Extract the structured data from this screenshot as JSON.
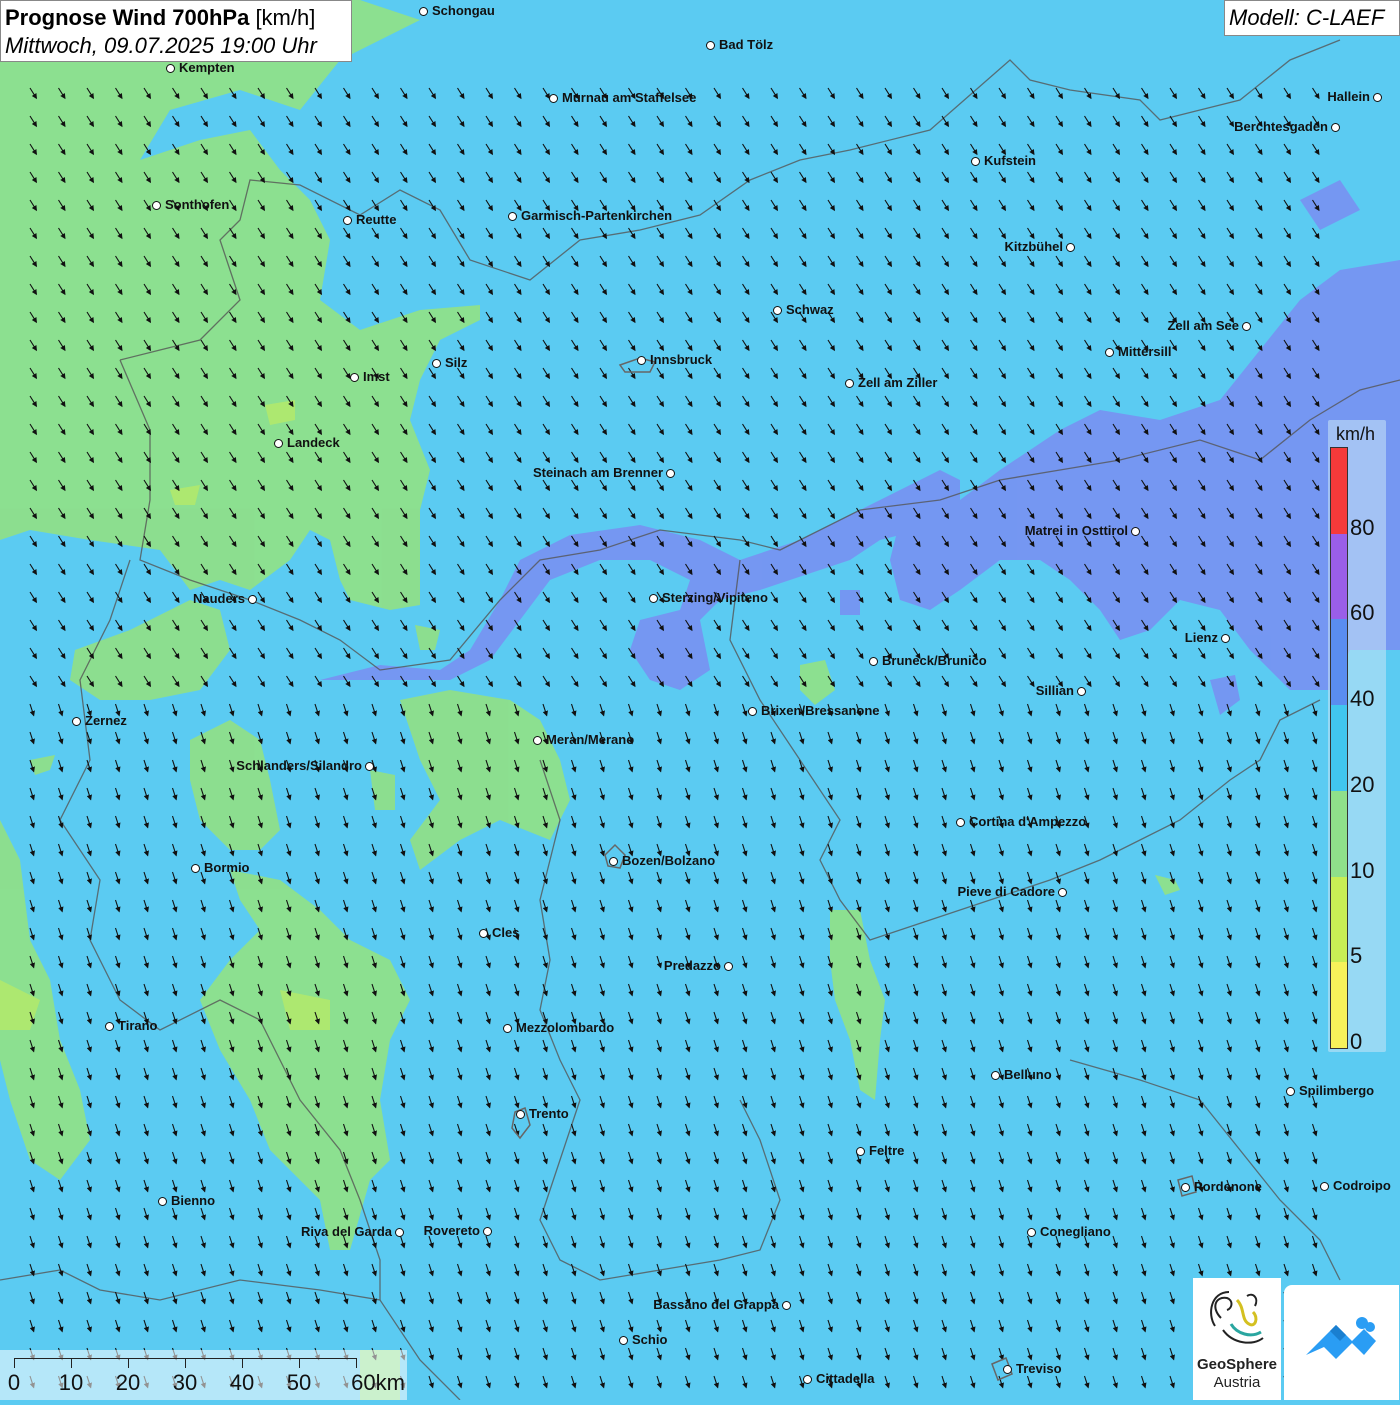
{
  "title": {
    "main": "Prognose Wind 700hPa",
    "unit": "[km/h]",
    "date": "Mittwoch, 09.07.2025 19:00 Uhr"
  },
  "model_label": "Modell: C-LAEF",
  "legend": {
    "unit": "km/h",
    "ticks": [
      "0",
      "5",
      "10",
      "20",
      "40",
      "60",
      "80"
    ],
    "colors": [
      "#f7f25a",
      "#c8ee55",
      "#8fe08a",
      "#41c6ee",
      "#5a8df0",
      "#9a5ee8",
      "#f53a3a"
    ]
  },
  "wind": {
    "arrow_direction": "from north-west, pointing south-south-east"
  },
  "scale_bar": {
    "labels": [
      "0",
      "10",
      "20",
      "30",
      "40",
      "50",
      "60km"
    ]
  },
  "cities": [
    {
      "name": "Schongau"
    },
    {
      "name": "Bad Tölz"
    },
    {
      "name": "Kempten"
    },
    {
      "name": "Murnau am Staffelsee"
    },
    {
      "name": "Hallein"
    },
    {
      "name": "Berchtesgaden"
    },
    {
      "name": "Kufstein"
    },
    {
      "name": "Sonthofen"
    },
    {
      "name": "Reutte"
    },
    {
      "name": "Garmisch-Partenkirchen"
    },
    {
      "name": "Kitzbühel"
    },
    {
      "name": "Schwaz"
    },
    {
      "name": "Zell am See"
    },
    {
      "name": "Mittersill"
    },
    {
      "name": "Silz"
    },
    {
      "name": "Innsbruck"
    },
    {
      "name": "Imst"
    },
    {
      "name": "Zell am Ziller"
    },
    {
      "name": "Landeck"
    },
    {
      "name": "Steinach am Brenner"
    },
    {
      "name": "Matrei in Osttirol"
    },
    {
      "name": "Nauders"
    },
    {
      "name": "Sterzing/Vipiteno"
    },
    {
      "name": "Lienz"
    },
    {
      "name": "Bruneck/Brunico"
    },
    {
      "name": "Sillian"
    },
    {
      "name": "Brixen/Bressanone"
    },
    {
      "name": "Zernez"
    },
    {
      "name": "Meran/Merano"
    },
    {
      "name": "Schlanders/Silandro"
    },
    {
      "name": "Cortina d'Ampezzo"
    },
    {
      "name": "Bozen/Bolzano"
    },
    {
      "name": "Bormio"
    },
    {
      "name": "Pieve di Cadore"
    },
    {
      "name": "Cles"
    },
    {
      "name": "Predazzo"
    },
    {
      "name": "Tirano"
    },
    {
      "name": "Mezzolombardo"
    },
    {
      "name": "Belluno"
    },
    {
      "name": "Spilimbergo"
    },
    {
      "name": "Trento"
    },
    {
      "name": "Feltre"
    },
    {
      "name": "Bienno"
    },
    {
      "name": "Pordenone"
    },
    {
      "name": "Codroipo"
    },
    {
      "name": "Riva del Garda"
    },
    {
      "name": "Rovereto"
    },
    {
      "name": "Conegliano"
    },
    {
      "name": "Bassano del Grappa"
    },
    {
      "name": "Schio"
    },
    {
      "name": "Treviso"
    },
    {
      "name": "Cittadella"
    }
  ],
  "logo": {
    "name": "GeoSphere",
    "sub": "Austria"
  }
}
